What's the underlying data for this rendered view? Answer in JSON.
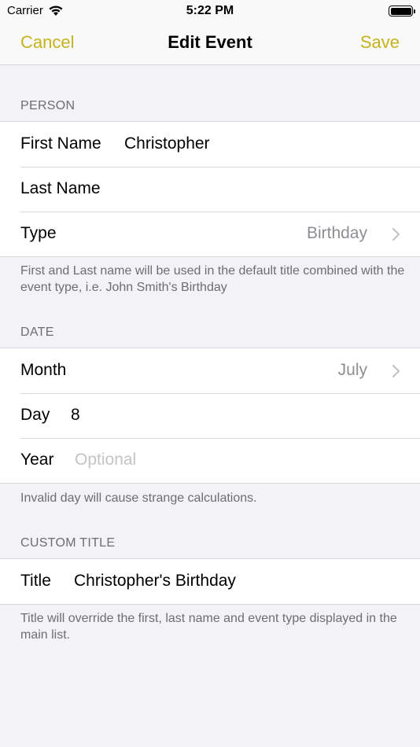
{
  "status_bar": {
    "carrier": "Carrier",
    "time": "5:22 PM"
  },
  "nav": {
    "cancel_label": "Cancel",
    "title": "Edit Event",
    "save_label": "Save",
    "accent_color": "#c7b21e"
  },
  "person": {
    "header": "PERSON",
    "first_name_label": "First Name",
    "first_name_value": "Christopher",
    "last_name_label": "Last Name",
    "last_name_value": "",
    "type_label": "Type",
    "type_value": "Birthday",
    "footer": "First and Last name will be used in the default title combined with the event type, i.e. John Smith's Birthday"
  },
  "date": {
    "header": "DATE",
    "month_label": "Month",
    "month_value": "July",
    "day_label": "Day",
    "day_value": "8",
    "year_label": "Year",
    "year_placeholder": "Optional",
    "footer": "Invalid day will cause strange calculations."
  },
  "custom_title": {
    "header": "CUSTOM TITLE",
    "title_label": "Title",
    "title_value": "Christopher's Birthday",
    "footer": "Title will override the first, last name and event type displayed in the main list."
  }
}
